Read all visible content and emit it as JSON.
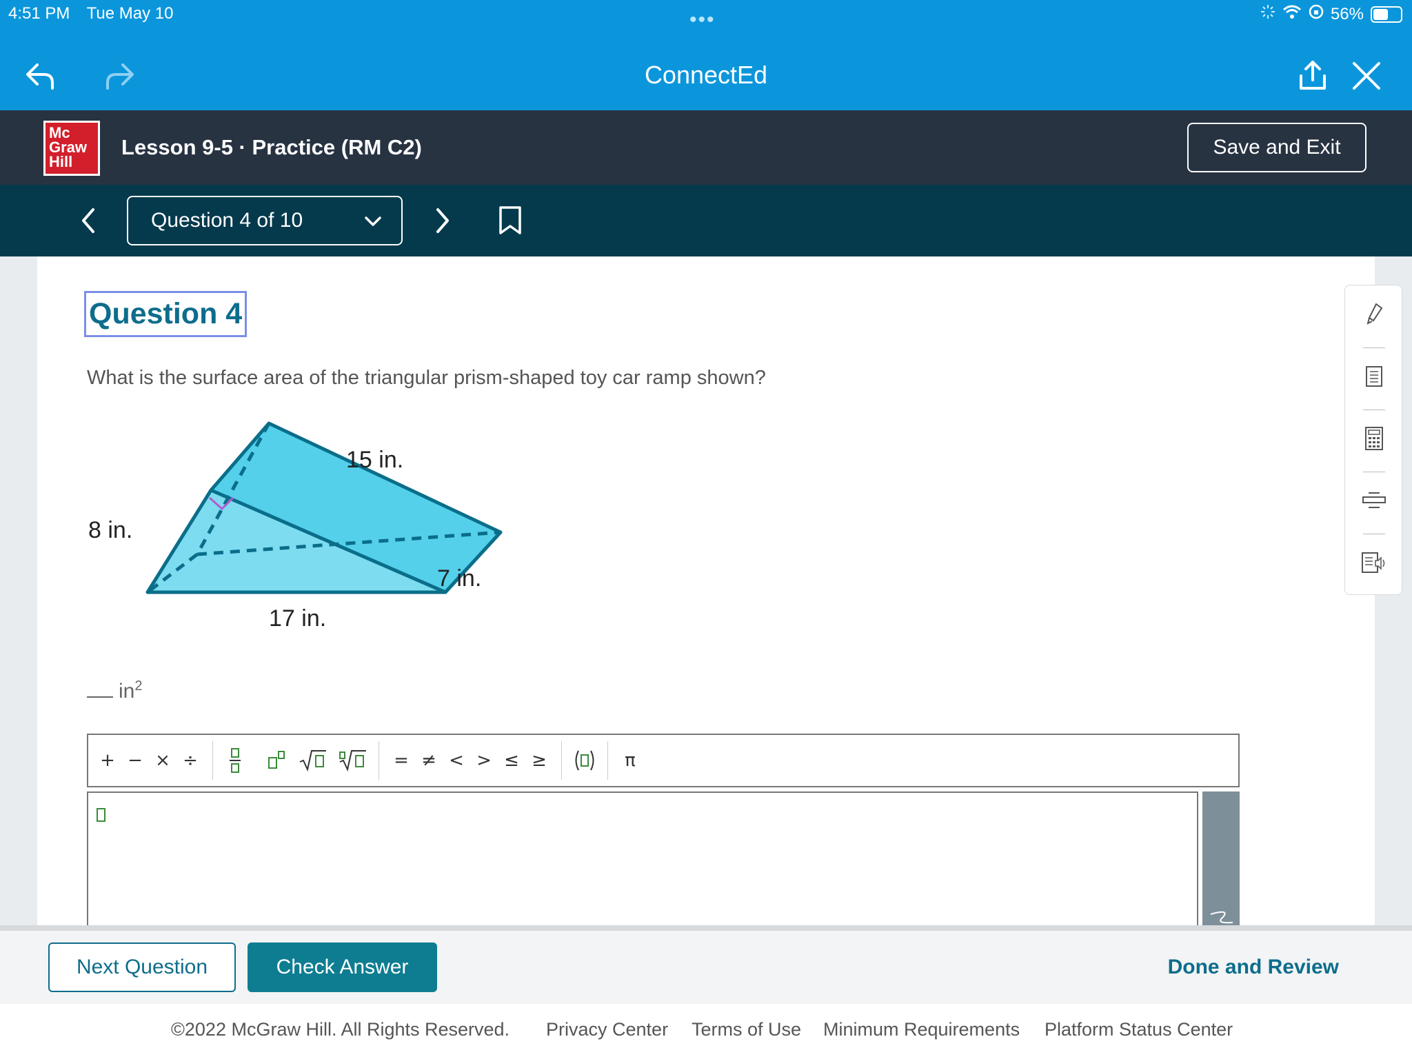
{
  "status_bar": {
    "time": "4:51 PM",
    "date": "Tue May 10",
    "battery": "56%",
    "battery_level": 0.56
  },
  "browser": {
    "title": "ConnectEd"
  },
  "lesson": {
    "logo_lines": [
      "Mc",
      "Graw",
      "Hill"
    ],
    "title": "Lesson 9-5 · Practice (RM C2)",
    "save_exit": "Save and Exit"
  },
  "question_nav": {
    "selector": "Question 4 of 10"
  },
  "question": {
    "heading": "Question 4",
    "text": "What is the surface area of the triangular prism-shaped toy car ramp shown?",
    "figure_labels": {
      "hyp": "15 in.",
      "height": "8 in.",
      "base": "17 in.",
      "depth": "7 in."
    },
    "answer_unit": "in",
    "answer_exponent": "2"
  },
  "math_toolbar": {
    "ops": [
      "+",
      "−",
      "×",
      "÷"
    ],
    "relations": [
      "=",
      "≠",
      "<",
      ">",
      "≤",
      "≥"
    ],
    "pi": "π"
  },
  "tools_panel": {
    "icons": [
      "highlighter-icon",
      "notepad-icon",
      "calculator-icon",
      "line-reader-icon",
      "read-aloud-icon"
    ]
  },
  "actions": {
    "next": "Next Question",
    "check": "Check Answer",
    "done": "Done and Review"
  },
  "footer": {
    "copyright": "©2022 McGraw Hill. All Rights Reserved.",
    "privacy": "Privacy Center",
    "terms": "Terms of Use",
    "requirements": "Minimum Requirements",
    "status": "Platform Status Center"
  },
  "colors": {
    "browser_bar": "#0b96dc",
    "lesson_bar": "#283342",
    "nav_bar": "#053a4d",
    "accent": "#0e7d92",
    "prism_light": "#7ddcef",
    "prism_dark": "#54d0ea"
  }
}
